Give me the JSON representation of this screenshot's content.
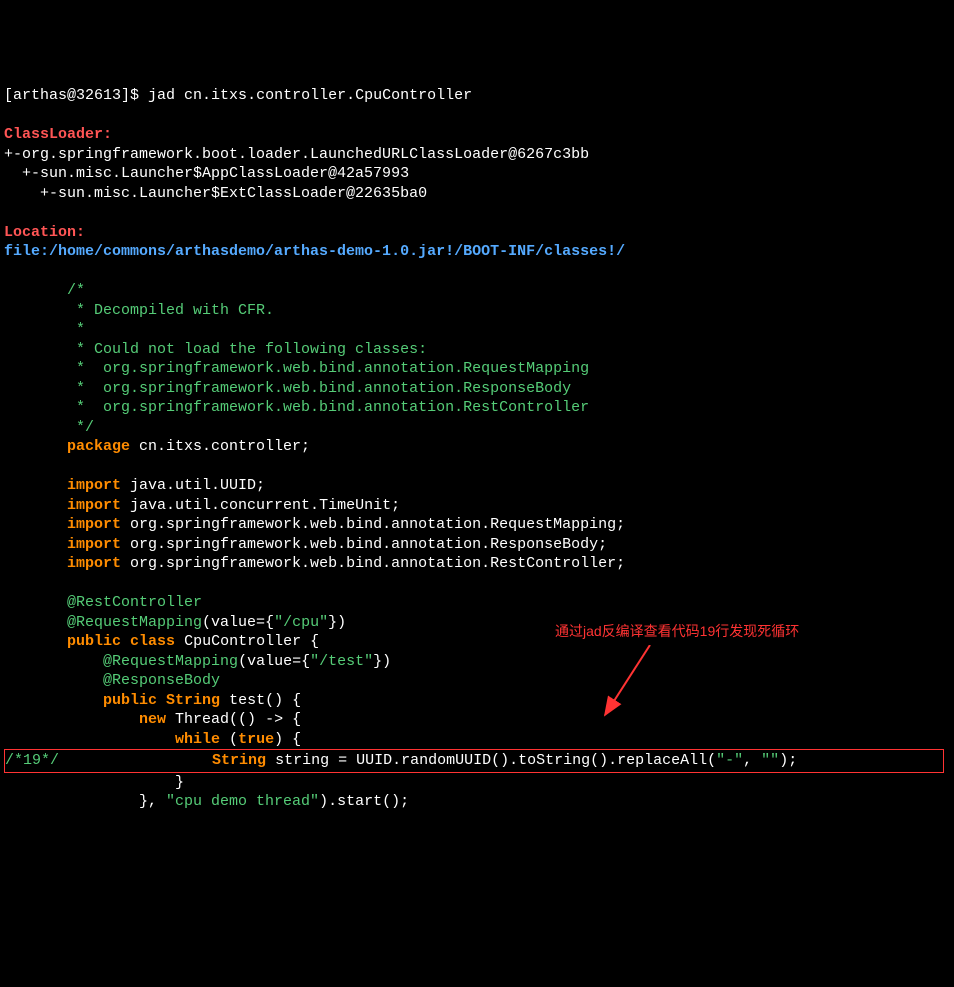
{
  "prompt": "[arthas@32613]$",
  "command": "jad cn.itxs.controller.CpuController",
  "headings": {
    "classloader": "ClassLoader:",
    "location": "Location:"
  },
  "classloader_lines": [
    "+-org.springframework.boot.loader.LaunchedURLClassLoader@6267c3bb",
    "  +-sun.misc.Launcher$AppClassLoader@42a57993",
    "    +-sun.misc.Launcher$ExtClassLoader@22635ba0"
  ],
  "location_path": "file:/home/commons/arthasdemo/arthas-demo-1.0.jar!/BOOT-INF/classes!/",
  "comments": [
    "       /*",
    "        * Decompiled with CFR.",
    "        *",
    "        * Could not load the following classes:",
    "        *  org.springframework.web.bind.annotation.RequestMapping",
    "        *  org.springframework.web.bind.annotation.ResponseBody",
    "        *  org.springframework.web.bind.annotation.RestController",
    "        */"
  ],
  "code": {
    "package_kw": "package",
    "package_name": " cn.itxs.controller;",
    "import_kw": "import",
    "imports": [
      " java.util.UUID;",
      " java.util.concurrent.TimeUnit;",
      " org.springframework.web.bind.annotation.RequestMapping;",
      " org.springframework.web.bind.annotation.ResponseBody;",
      " org.springframework.web.bind.annotation.RestController;"
    ],
    "rest_controller": "@RestController",
    "req_mapping1_pre": "@RequestMapping",
    "req_mapping1_mid": "(value={",
    "req_mapping1_str": "\"/cpu\"",
    "req_mapping1_end": "})",
    "public_kw": "public",
    "class_kw": "class",
    "class_name": " CpuController {",
    "req_mapping2_pre": "@RequestMapping",
    "req_mapping2_mid": "(value={",
    "req_mapping2_str": "\"/test\"",
    "req_mapping2_end": "})",
    "response_body": "@ResponseBody",
    "string_kw": " String",
    "test_method": " test() {",
    "new_kw": "new",
    "thread_part": " Thread(() -> {",
    "while_kw": "while",
    "true_kw": "true",
    "paren_open": " (",
    "paren_close": ") {",
    "line19_marker": "/*19*/",
    "line19_string": "String",
    "line19_assign": " string = UUID.randomUUID().toString().replaceAll(",
    "line19_arg1": "\"-\"",
    "line19_comma": ", ",
    "line19_arg2": "\"\"",
    "line19_end": ");",
    "close_brace": "                   }",
    "start_line_pre": "               }, ",
    "start_line_str": "\"cpu demo thread\"",
    "start_line_end": ").start();"
  },
  "annotation": "通过jad反编译查看代码19行发现死循环"
}
